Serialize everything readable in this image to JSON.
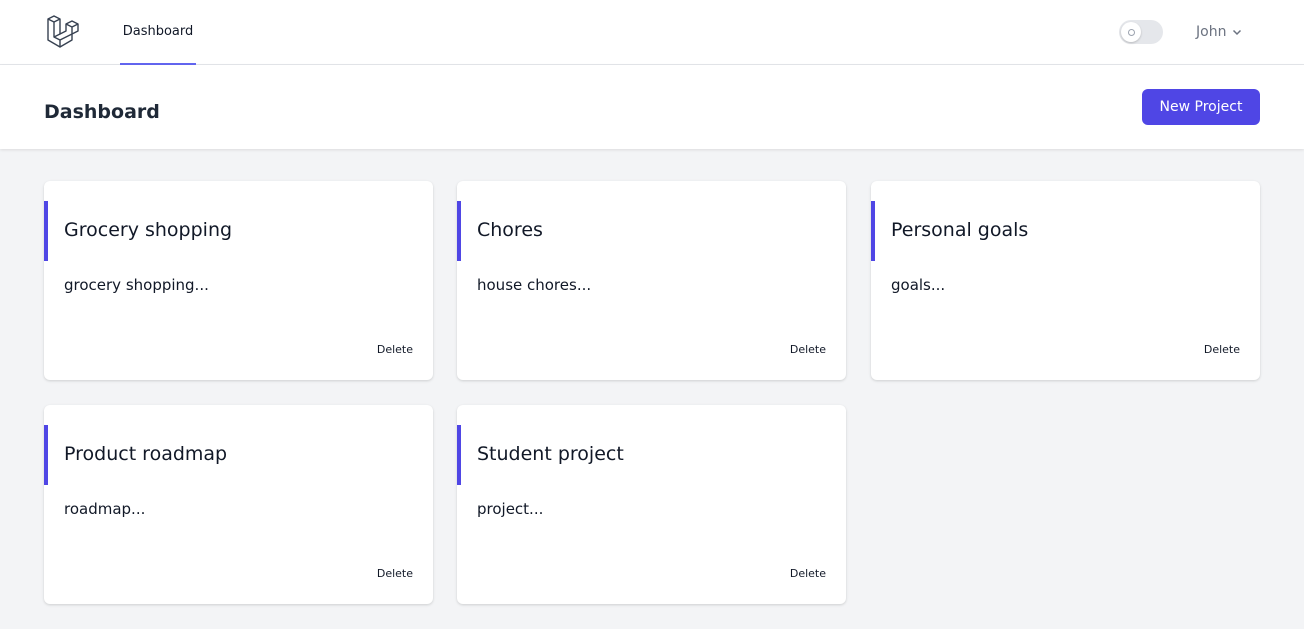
{
  "nav": {
    "logo": "laravel-logo",
    "links": [
      {
        "label": "Dashboard",
        "active": true
      }
    ],
    "theme_toggle": {
      "on": false
    },
    "user": {
      "name": "John",
      "icon": "chevron-down-icon"
    }
  },
  "header": {
    "title": "Dashboard",
    "new_project_label": "New Project"
  },
  "colors": {
    "accent": "#4f46e5",
    "nav_underline": "#6366f1",
    "background": "#f3f4f6"
  },
  "projects": [
    {
      "title": "Grocery shopping",
      "description": "grocery shopping...",
      "delete_label": "Delete"
    },
    {
      "title": "Chores",
      "description": "house chores...",
      "delete_label": "Delete"
    },
    {
      "title": "Personal goals",
      "description": "goals...",
      "delete_label": "Delete"
    },
    {
      "title": "Product roadmap",
      "description": "roadmap...",
      "delete_label": "Delete"
    },
    {
      "title": "Student project",
      "description": "project...",
      "delete_label": "Delete"
    }
  ]
}
